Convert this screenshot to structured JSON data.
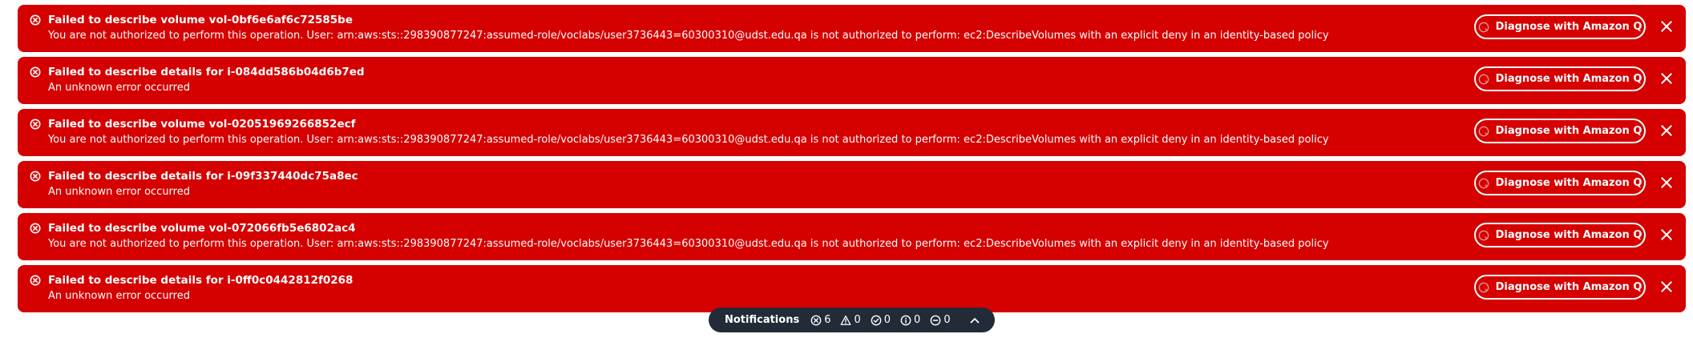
{
  "flashbar": {
    "items": [
      {
        "title": "Failed to describe volume vol-0bf6e6af6c72585be",
        "message": "You are not authorized to perform this operation. User: arn:aws:sts::298390877247:assumed-role/voclabs/user3736443=60300310@udst.edu.qa is not authorized to perform: ec2:DescribeVolumes with an explicit deny in an identity-based policy",
        "action_label": "Diagnose with Amazon Q"
      },
      {
        "title": "Failed to describe details for i-084dd586b04d6b7ed",
        "message": "An unknown error occurred",
        "action_label": "Diagnose with Amazon Q"
      },
      {
        "title": "Failed to describe volume vol-02051969266852ecf",
        "message": "You are not authorized to perform this operation. User: arn:aws:sts::298390877247:assumed-role/voclabs/user3736443=60300310@udst.edu.qa is not authorized to perform: ec2:DescribeVolumes with an explicit deny in an identity-based policy",
        "action_label": "Diagnose with Amazon Q"
      },
      {
        "title": "Failed to describe details for i-09f337440dc75a8ec",
        "message": "An unknown error occurred",
        "action_label": "Diagnose with Amazon Q"
      },
      {
        "title": "Failed to describe volume vol-072066fb5e6802ac4",
        "message": "You are not authorized to perform this operation. User: arn:aws:sts::298390877247:assumed-role/voclabs/user3736443=60300310@udst.edu.qa is not authorized to perform: ec2:DescribeVolumes with an explicit deny in an identity-based policy",
        "action_label": "Diagnose with Amazon Q"
      },
      {
        "title": "Failed to describe details for i-0ff0c0442812f0268",
        "message": "An unknown error occurred",
        "action_label": "Diagnose with Amazon Q"
      }
    ],
    "error_color": "#d50000",
    "item_icon": "error-circle-icon",
    "dismiss_icon": "close-icon"
  },
  "notifications": {
    "label": "Notifications",
    "background_color": "#222b37",
    "counts": [
      {
        "icon": "error-icon",
        "value": "6"
      },
      {
        "icon": "warning-icon",
        "value": "0"
      },
      {
        "icon": "success-icon",
        "value": "0"
      },
      {
        "icon": "info-icon",
        "value": "0"
      },
      {
        "icon": "in-progress-icon",
        "value": "0"
      }
    ],
    "toggle_icon": "chevron-up-icon"
  }
}
